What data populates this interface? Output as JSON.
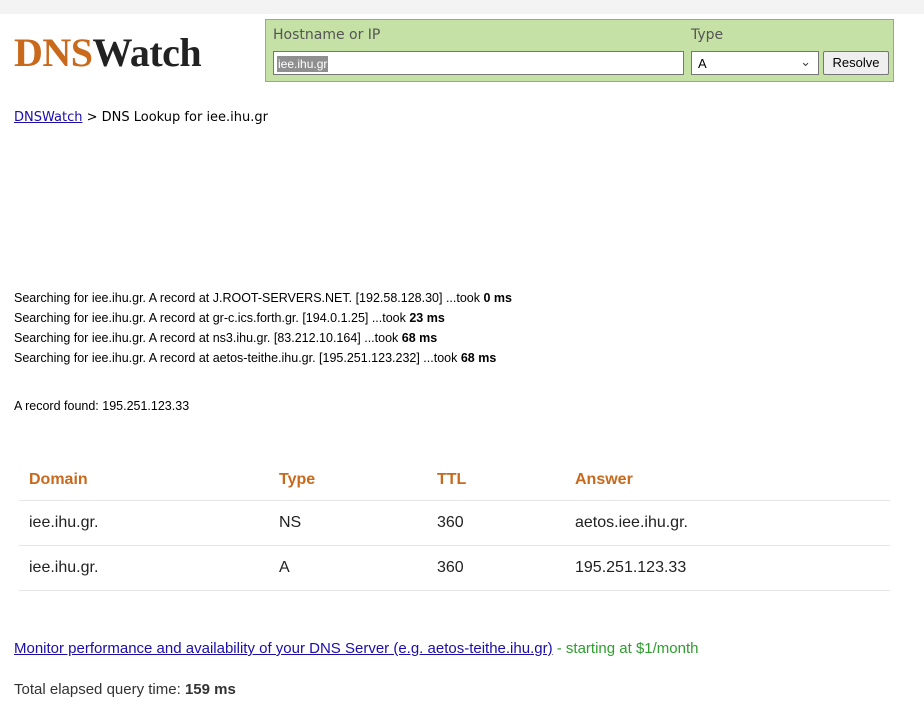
{
  "logo": {
    "part1": "DNS",
    "part2": "Watch"
  },
  "search": {
    "hostname_label": "Hostname or IP",
    "hostname_value": "iee.ihu.gr",
    "type_label": "Type",
    "type_value": "A",
    "resolve_label": "Resolve"
  },
  "breadcrumb": {
    "home": "DNSWatch",
    "separator": " > ",
    "current": "DNS Lookup for iee.ihu.gr"
  },
  "log": [
    {
      "text": "Searching for iee.ihu.gr. A record at J.ROOT-SERVERS.NET. [192.58.128.30] ...took ",
      "time": "0 ms"
    },
    {
      "text": "Searching for iee.ihu.gr. A record at gr-c.ics.forth.gr. [194.0.1.25] ...took ",
      "time": "23 ms"
    },
    {
      "text": "Searching for iee.ihu.gr. A record at ns3.ihu.gr. [83.212.10.164] ...took ",
      "time": "68 ms"
    },
    {
      "text": "Searching for iee.ihu.gr. A record at aetos-teithe.ihu.gr. [195.251.123.232] ...took ",
      "time": "68 ms"
    }
  ],
  "found": "A record found: 195.251.123.33",
  "table": {
    "headers": [
      "Domain",
      "Type",
      "TTL",
      "Answer"
    ],
    "rows": [
      [
        "iee.ihu.gr.",
        "NS",
        "360",
        "aetos.iee.ihu.gr."
      ],
      [
        "iee.ihu.gr.",
        "A",
        "360",
        "195.251.123.33"
      ]
    ]
  },
  "monitor": {
    "link": "Monitor performance and availability of your DNS Server (e.g. aetos-teithe.ihu.gr)",
    "suffix": " - starting at $1/month"
  },
  "total": {
    "label": "Total elapsed query time: ",
    "value": "159 ms"
  },
  "colors": {
    "brand_orange": "#c8691c",
    "panel_green": "#c5e1a5",
    "link_blue": "#1a0dab",
    "promo_green": "#2e9d2e"
  }
}
